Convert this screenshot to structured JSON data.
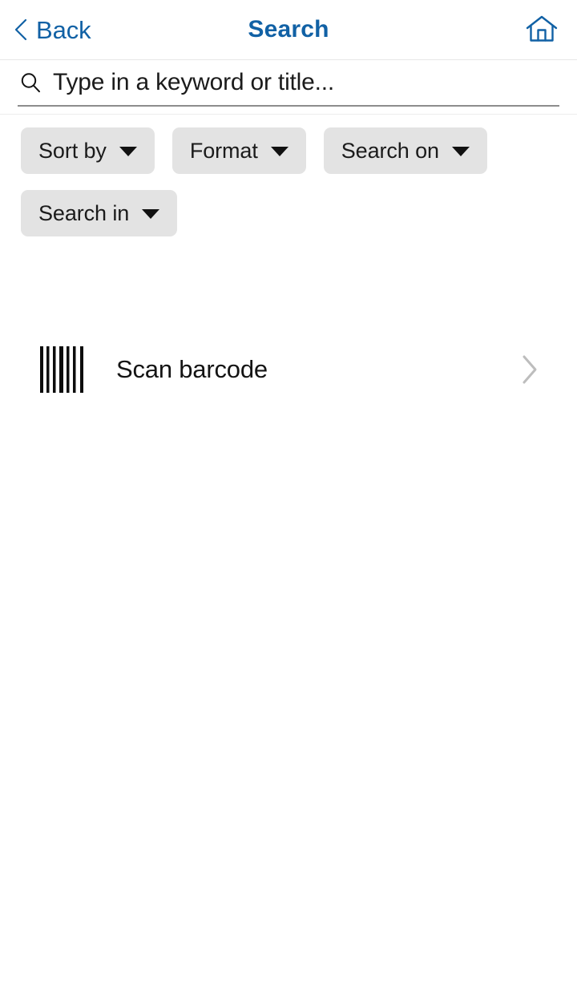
{
  "header": {
    "back_label": "Back",
    "title": "Search",
    "back_icon": "chevron-left-icon",
    "home_icon": "home-icon"
  },
  "search": {
    "icon": "search-icon",
    "value": "",
    "placeholder": "Type in a keyword or title..."
  },
  "filters": {
    "chips": [
      {
        "label": "Sort by",
        "icon": "caret-down-icon"
      },
      {
        "label": "Format",
        "icon": "caret-down-icon"
      },
      {
        "label": "Search on",
        "icon": "caret-down-icon"
      },
      {
        "label": "Search in",
        "icon": "caret-down-icon"
      }
    ]
  },
  "actions": {
    "scan": {
      "label": "Scan barcode",
      "icon": "barcode-icon",
      "accessory_icon": "chevron-right-icon"
    }
  },
  "colors": {
    "accent": "#1161a5",
    "chip_background": "#e3e3e3",
    "text": "#1b1b1b",
    "chevron_gray": "#bdbdbd",
    "divider": "#e8e8e8",
    "input_underline": "#8d8d8d"
  }
}
